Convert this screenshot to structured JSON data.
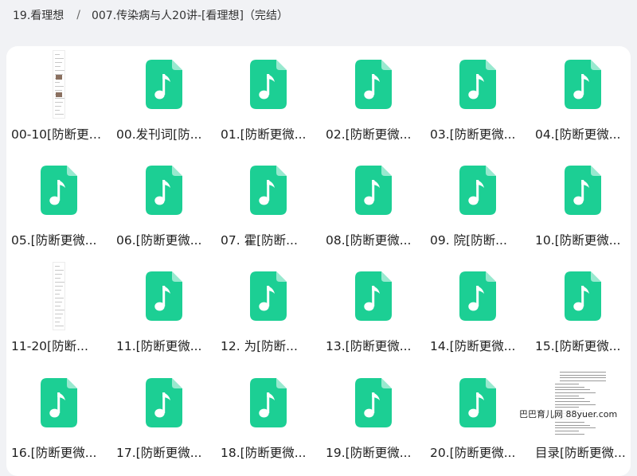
{
  "breadcrumb": {
    "parent": "19.看理想",
    "separator": "/",
    "current": "007.传染病与人20讲-[看理想]（完结）"
  },
  "colors": {
    "audio_icon": "#1ccf94",
    "background": "#f1f2f5",
    "panel": "#ffffff"
  },
  "files": [
    {
      "label": "00-10[防断更微...",
      "type": "document",
      "icon": "document-thumbnail"
    },
    {
      "label": "00.发刊词[防...",
      "type": "audio",
      "icon": "music-file-icon"
    },
    {
      "label": "01.[防断更微...",
      "type": "audio",
      "icon": "music-file-icon"
    },
    {
      "label": "02.[防断更微...",
      "type": "audio",
      "icon": "music-file-icon"
    },
    {
      "label": "03.[防断更微...",
      "type": "audio",
      "icon": "music-file-icon"
    },
    {
      "label": "04.[防断更微...",
      "type": "audio",
      "icon": "music-file-icon"
    },
    {
      "label": "05.[防断更微...",
      "type": "audio",
      "icon": "music-file-icon"
    },
    {
      "label": "06.[防断更微...",
      "type": "audio",
      "icon": "music-file-icon"
    },
    {
      "label": "07. 霍[防断...",
      "type": "audio",
      "icon": "music-file-icon"
    },
    {
      "label": "08.[防断更微...",
      "type": "audio",
      "icon": "music-file-icon"
    },
    {
      "label": "09. 院[防断...",
      "type": "audio",
      "icon": "music-file-icon"
    },
    {
      "label": "10.[防断更微...",
      "type": "audio",
      "icon": "music-file-icon"
    },
    {
      "label": "11-20[防断...",
      "type": "document",
      "icon": "document-thumbnail"
    },
    {
      "label": "11.[防断更微...",
      "type": "audio",
      "icon": "music-file-icon"
    },
    {
      "label": "12. 为[防断...",
      "type": "audio",
      "icon": "music-file-icon"
    },
    {
      "label": "13.[防断更微...",
      "type": "audio",
      "icon": "music-file-icon"
    },
    {
      "label": "14.[防断更微...",
      "type": "audio",
      "icon": "music-file-icon"
    },
    {
      "label": "15.[防断更微...",
      "type": "audio",
      "icon": "music-file-icon"
    },
    {
      "label": "16.[防断更微...",
      "type": "audio",
      "icon": "music-file-icon"
    },
    {
      "label": "17.[防断更微...",
      "type": "audio",
      "icon": "music-file-icon"
    },
    {
      "label": "18.[防断更微...",
      "type": "audio",
      "icon": "music-file-icon"
    },
    {
      "label": "19.[防断更微...",
      "type": "audio",
      "icon": "music-file-icon"
    },
    {
      "label": "20.[防断更微...",
      "type": "audio",
      "icon": "music-file-icon"
    },
    {
      "label": "目录[防断更微...",
      "type": "document",
      "icon": "document-thumbnail"
    }
  ],
  "watermark": "巴巴育儿网 88yuer.com"
}
